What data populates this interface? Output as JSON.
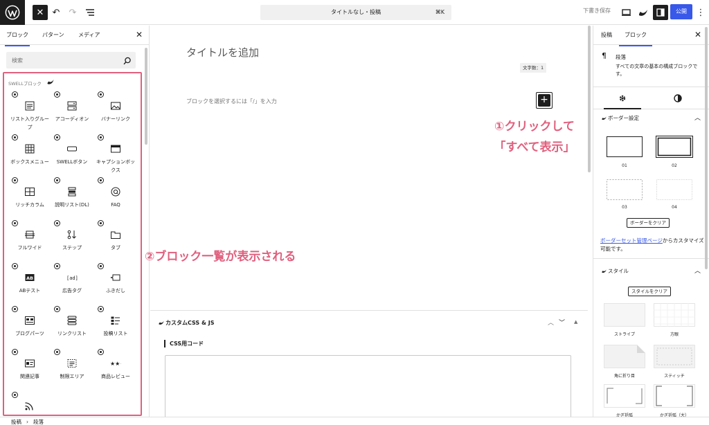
{
  "toolbar": {
    "command_bar": "タイトルなし・投稿",
    "command_shortcut": "⌘K",
    "save_draft": "下書き保存",
    "publish": "公開"
  },
  "inserter": {
    "tabs": [
      "ブロック",
      "パターン",
      "メディア"
    ],
    "search_placeholder": "検索",
    "category": "SWELLブロック",
    "blocks": [
      {
        "label": "リスト入りグループ",
        "icon": "list-icon"
      },
      {
        "label": "アコーディオン",
        "icon": "accordion-icon"
      },
      {
        "label": "バナーリンク",
        "icon": "image-icon"
      },
      {
        "label": "ボックスメニュー",
        "icon": "grid-icon"
      },
      {
        "label": "SWELLボタン",
        "icon": "button-icon"
      },
      {
        "label": "キャプションボックス",
        "icon": "caption-box-icon"
      },
      {
        "label": "リッチカラム",
        "icon": "columns-icon"
      },
      {
        "label": "説明リスト(DL)",
        "icon": "dl-icon"
      },
      {
        "label": "FAQ",
        "icon": "faq-icon"
      },
      {
        "label": "フルワイド",
        "icon": "full-wide-icon"
      },
      {
        "label": "ステップ",
        "icon": "step-icon"
      },
      {
        "label": "タブ",
        "icon": "tab-icon"
      },
      {
        "label": "ABテスト",
        "icon": "ab-test-icon"
      },
      {
        "label": "広告タグ",
        "icon": "ad-icon"
      },
      {
        "label": "ふきだし",
        "icon": "balloon-icon"
      },
      {
        "label": "ブログパーツ",
        "icon": "blog-parts-icon"
      },
      {
        "label": "リンクリスト",
        "icon": "link-list-icon"
      },
      {
        "label": "投稿リスト",
        "icon": "post-list-icon"
      },
      {
        "label": "関連記事",
        "icon": "related-post-icon"
      },
      {
        "label": "制限エリア",
        "icon": "restricted-area-icon"
      },
      {
        "label": "商品レビュー",
        "icon": "review-icon"
      },
      {
        "label": "",
        "icon": "rss-icon"
      }
    ]
  },
  "editor": {
    "title_placeholder": "タイトルを追加",
    "word_count": "文字数：1",
    "paragraph_placeholder": "ブロックを選択するには「/」を入力",
    "annotation_1_line1": "①クリックして",
    "annotation_1_line2": "「すべて表示」",
    "annotation_2": "②ブロック一覧が表示される",
    "meta_box_title": "カスタムCSS & JS",
    "css_label": "CSS用コード"
  },
  "settings": {
    "tabs": [
      "投稿",
      "ブロック"
    ],
    "block_name": "段落",
    "block_desc": "すべての文章の基本の構成ブロックです。",
    "border_section": "ボーダー設定",
    "border_options": [
      "01",
      "02",
      "03",
      "04"
    ],
    "border_clear": "ボーダーをクリア",
    "border_link": "ボーダーセット管理ページ",
    "border_link_suffix": "からカスタマイズ可能です。",
    "style_section": "スタイル",
    "style_clear": "スタイルをクリア",
    "style_options": [
      "ストライプ",
      "方眼",
      "角に折り目",
      "スティッチ",
      "かぎ括弧",
      "かぎ括弧（大）"
    ]
  },
  "footer": {
    "crumbs": [
      "投稿",
      "段落"
    ]
  },
  "colors": {
    "accent": "#3858e9",
    "annotation": "#e0607e",
    "dark": "#1e1e1e"
  }
}
